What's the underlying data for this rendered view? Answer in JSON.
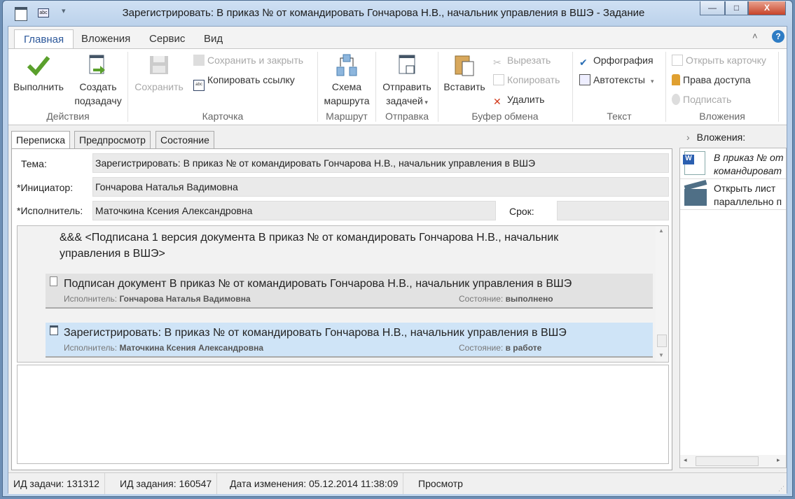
{
  "window": {
    "title": "Зарегистрировать: В приказ № от  командировать Гончарова Н.В., начальник управления в ВШЭ - Задание",
    "minimize": "—",
    "maximize": "□",
    "close": "X"
  },
  "ribbon_tabs": [
    "Главная",
    "Вложения",
    "Сервис",
    "Вид"
  ],
  "ribbon": {
    "actions": {
      "execute": "Выполнить",
      "subtask_1": "Создать",
      "subtask_2": "подзадачу",
      "label": "Действия"
    },
    "card": {
      "save": "Сохранить",
      "save_close": "Сохранить и закрыть",
      "copy_link": "Копировать ссылку",
      "label": "Карточка"
    },
    "route": {
      "scheme_1": "Схема",
      "scheme_2": "маршрута",
      "label": "Маршрут"
    },
    "send": {
      "send_1": "Отправить",
      "send_2": "задачей",
      "label": "Отправка"
    },
    "clipboard": {
      "paste": "Вставить",
      "cut": "Вырезать",
      "copy": "Копировать",
      "delete": "Удалить",
      "label": "Буфер обмена"
    },
    "text": {
      "spelling": "Орфография",
      "autotexts": "Автотексты",
      "label": "Текст"
    },
    "attachments": {
      "open_card": "Открыть карточку",
      "access": "Права доступа",
      "sign": "Подписать",
      "label": "Вложения"
    }
  },
  "tabs": [
    "Переписка",
    "Предпросмотр",
    "Состояние"
  ],
  "form": {
    "subject_label": "Тема:",
    "subject": "Зарегистрировать: В приказ № от  командировать Гончарова Н.В., начальник управления в ВШЭ",
    "initiator_label": "*Инициатор:",
    "initiator": "Гончарова Наталья Вадимовна",
    "executor_label": "*Исполнитель:",
    "executor": "Маточкина Ксения Александровна",
    "deadline_label": "Срок:",
    "deadline": ""
  },
  "conversation": {
    "note_line1": "&&& <Подписана 1 версия документа В приказ № от  командировать Гончарова Н.В., начальник",
    "note_line2": "управления в ВШЭ>",
    "items": [
      {
        "title": "Подписан документ В приказ № от командировать Гончарова Н.В., начальник управления в ВШЭ",
        "executor_label": "Исполнитель:",
        "executor": "Гончарова Наталья Вадимовна",
        "state_label": "Состояние:",
        "state": "выполнено"
      },
      {
        "title": "Зарегистрировать: В приказ № от командировать Гончарова Н.В., начальник управления в ВШЭ",
        "executor_label": "Исполнитель:",
        "executor": "Маточкина Ксения Александровна",
        "state_label": "Состояние:",
        "state": "в работе"
      }
    ]
  },
  "attachments_panel": {
    "title": "Вложения:",
    "items": [
      {
        "line1": "В приказ № от",
        "line2": "командироват"
      },
      {
        "line1": "Открыть лист",
        "line2": "параллельно п"
      }
    ]
  },
  "status": {
    "task_id": "ИД задачи: 131312",
    "assignment_id": "ИД задания: 160547",
    "modified": "Дата изменения: 05.12.2014 11:38:09",
    "mode": "Просмотр"
  }
}
